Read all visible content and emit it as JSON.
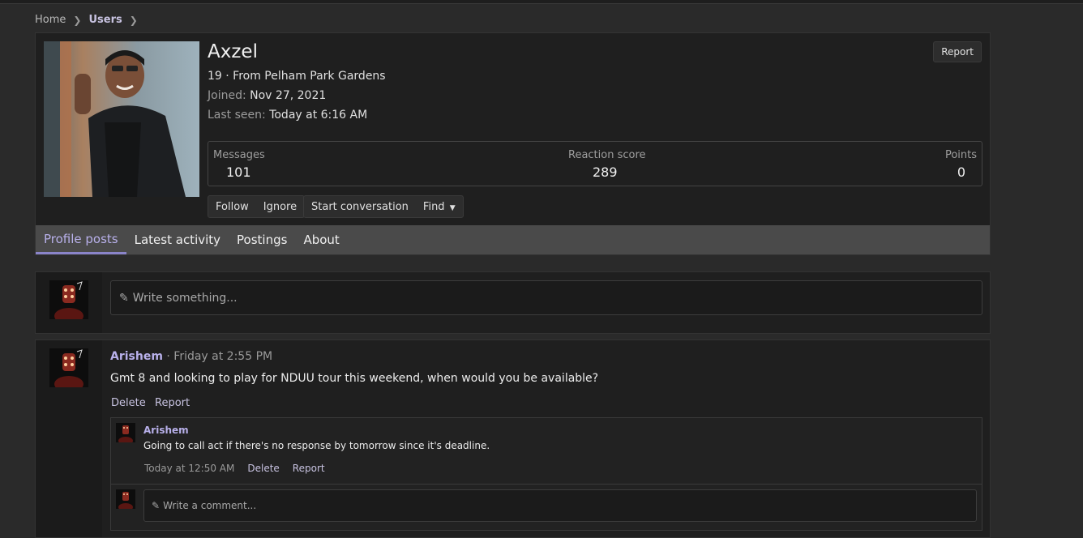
{
  "breadcrumb": {
    "home": "Home",
    "users": "Users"
  },
  "profile": {
    "name": "Axzel",
    "subtitle": "19 · From Pelham Park Gardens",
    "joined_label": "Joined:",
    "joined_value": "Nov 27, 2021",
    "last_seen_label": "Last seen:",
    "last_seen_value": "Today at 6:16 AM",
    "report_label": "Report",
    "stats": {
      "messages_label": "Messages",
      "messages_value": "101",
      "reaction_label": "Reaction score",
      "reaction_value": "289",
      "points_label": "Points",
      "points_value": "0"
    },
    "actions": {
      "follow": "Follow",
      "ignore": "Ignore",
      "start_conversation": "Start conversation",
      "find": "Find"
    }
  },
  "tabs": [
    "Profile posts",
    "Latest activity",
    "Postings",
    "About"
  ],
  "composer": {
    "placeholder": "Write something..."
  },
  "post": {
    "author": "Arishem",
    "time": "Friday at 2:55 PM",
    "text": "Gmt 8 and looking to play for NDUU tour this weekend, when would you be available?",
    "delete": "Delete",
    "report": "Report",
    "comment": {
      "author": "Arishem",
      "text": "Going to call act if there's no response by tomorrow since it's deadline.",
      "time": "Today at 12:50 AM",
      "delete": "Delete",
      "report": "Report"
    },
    "comment_placeholder": "Write a comment..."
  },
  "colors": {
    "accent": "#b8b0ea",
    "tab_bar": "#4a4a4a",
    "card_bg": "#1f1f1f",
    "page_bg": "#2a2a2a"
  }
}
